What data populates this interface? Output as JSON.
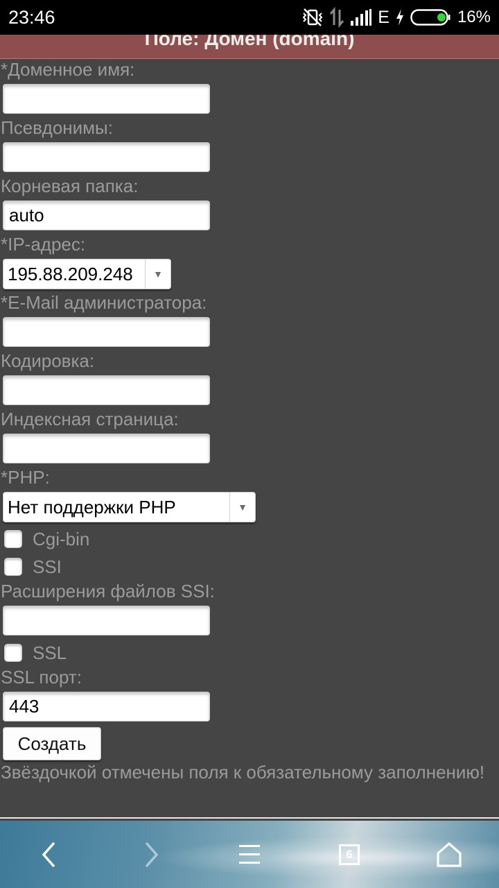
{
  "status_bar": {
    "time": "23:46",
    "network": "E",
    "battery": "16%",
    "icons": [
      "vibrate-off-icon",
      "data-transfer-icon",
      "signal-icon",
      "charging-icon",
      "battery-icon"
    ]
  },
  "header": {
    "title": "Поле: Домен (domain)",
    "color": "#8e4e4e"
  },
  "form": {
    "domain_label": "*Доменное имя:",
    "domain_value": "",
    "aliases_label": "Псевдонимы:",
    "aliases_value": "",
    "root_label": "Корневая папка:",
    "root_value": "auto",
    "ip_label": "*IP-адрес:",
    "ip_value": "195.88.209.248",
    "email_label": "*E-Mail администратора:",
    "email_value": "",
    "encoding_label": "Кодировка:",
    "encoding_value": "",
    "index_label": "Индексная страница:",
    "index_value": "",
    "php_label": "*PHP:",
    "php_value": "Нет поддержки PHP",
    "cgi_label": "Cgi-bin",
    "cgi_checked": false,
    "ssi_label": "SSI",
    "ssi_checked": false,
    "ssi_ext_label": "Расширения файлов SSI:",
    "ssi_ext_value": "",
    "ssl_label": "SSL",
    "ssl_checked": false,
    "ssl_port_label": "SSL порт:",
    "ssl_port_value": "443",
    "submit_label": "Создать",
    "required_note": "Звёздочкой отмечены поля к обязательному заполнению!"
  },
  "browser_bar": {
    "tabs_count": "6",
    "icons": [
      "back-icon",
      "forward-icon",
      "menu-icon",
      "tabs-icon",
      "home-icon"
    ]
  }
}
